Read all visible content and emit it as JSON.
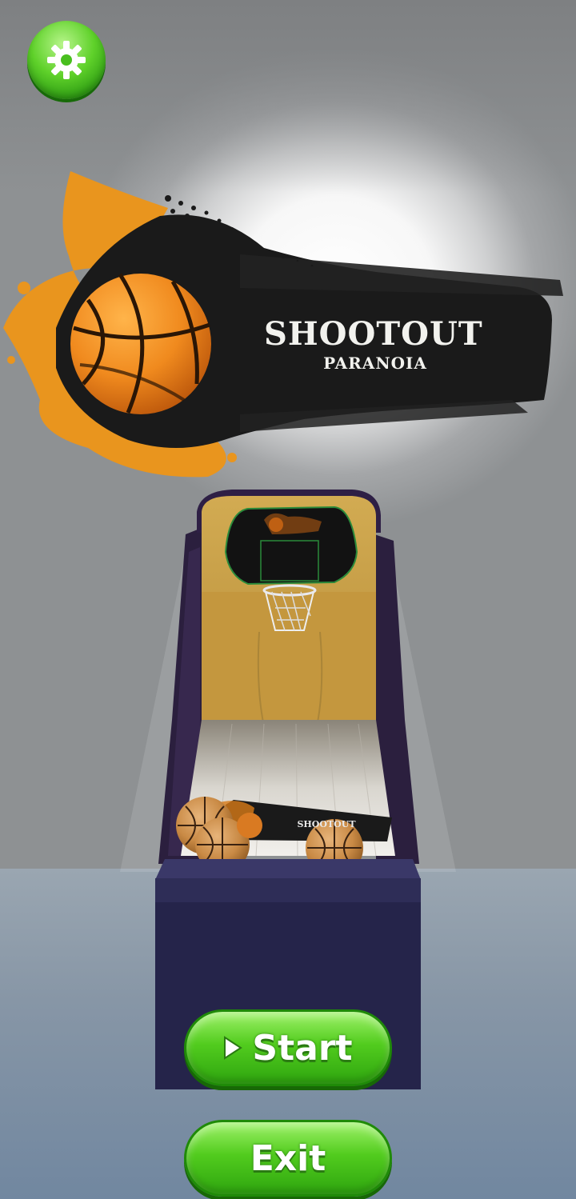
{
  "logo": {
    "title": "SHOOTOUT",
    "subtitle": "PARANOIA"
  },
  "machine": {
    "mini_label": "SHOOTOUT"
  },
  "buttons": {
    "start_label": "Start",
    "exit_label": "Exit"
  },
  "icons": {
    "settings": "gear-icon",
    "start": "play-icon",
    "logo_ball": "basketball-icon"
  },
  "colors": {
    "button_green": "#52cc1e",
    "ball_orange": "#f08a1e",
    "paint_orange": "#e9951e",
    "cabinet_navy": "#25244a",
    "backboard_wood": "#c9a24a"
  }
}
